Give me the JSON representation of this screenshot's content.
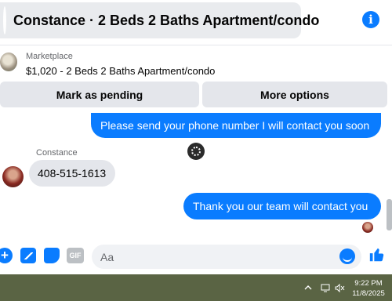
{
  "header": {
    "title": "Constance · 2 Beds 2 Baths Apartment/condo",
    "info_icon": "info-icon"
  },
  "listing": {
    "label": "Marketplace",
    "title": "$1,020 - 2 Beds 2 Baths Apartment/condo",
    "actions": {
      "mark_pending": "Mark as pending",
      "more_options": "More options"
    }
  },
  "conversation": {
    "messages": [
      {
        "direction": "outgoing",
        "text": "Please send your phone number I will contact you soon"
      },
      {
        "direction": "incoming",
        "sender": "Constance",
        "text": "408-515-1613"
      },
      {
        "direction": "outgoing",
        "text": "Thank you our team will contact you"
      }
    ]
  },
  "composer": {
    "placeholder": "Aa",
    "icons": [
      "plus-icon",
      "photo-icon",
      "sticker-icon",
      "gif-icon",
      "emoji-icon",
      "like-icon"
    ],
    "gif_label": "GIF"
  },
  "taskbar": {
    "time": "9:22 PM",
    "date": "11/8/2025"
  },
  "colors": {
    "accent": "#0a7cff",
    "bubble_incoming": "#e4e6eb",
    "button_bg": "#e4e6eb",
    "taskbar": "#5a6444"
  }
}
